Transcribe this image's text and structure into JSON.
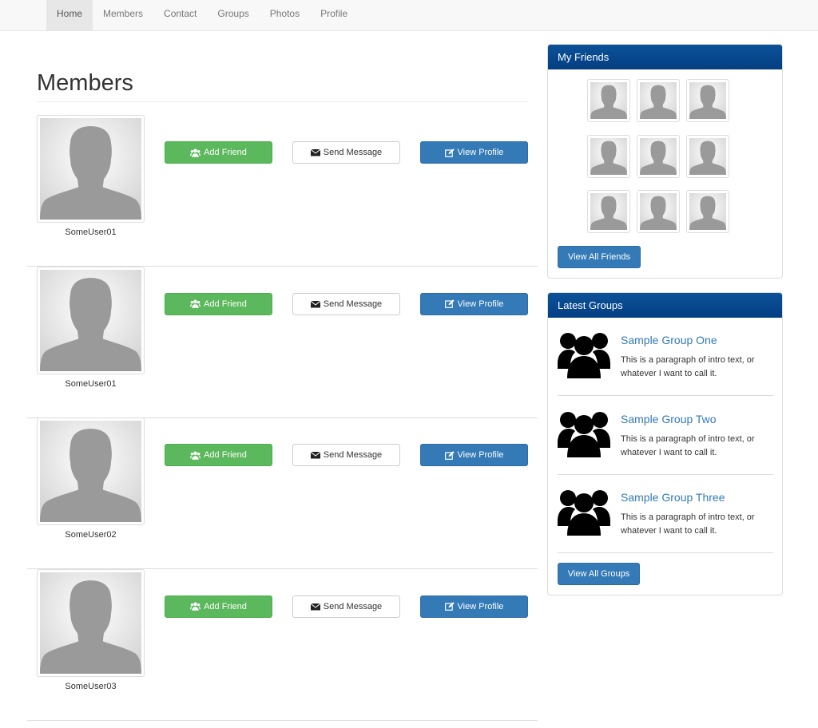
{
  "nav": {
    "items": [
      {
        "label": "Home",
        "active": true
      },
      {
        "label": "Members",
        "active": false
      },
      {
        "label": "Contact",
        "active": false
      },
      {
        "label": "Groups",
        "active": false
      },
      {
        "label": "Photos",
        "active": false
      },
      {
        "label": "Profile",
        "active": false
      }
    ]
  },
  "main": {
    "title": "Members",
    "members": [
      {
        "username": "SomeUser01"
      },
      {
        "username": "SomeUser01"
      },
      {
        "username": "SomeUser02"
      },
      {
        "username": "SomeUser03"
      }
    ],
    "buttons": {
      "add_friend": "Add Friend",
      "send_message": "Send Message",
      "view_profile": "View Profile"
    }
  },
  "friends_panel": {
    "title": "My Friends",
    "button": "View All Friends"
  },
  "groups_panel": {
    "title": "Latest Groups",
    "groups": [
      {
        "name": "Sample Group One",
        "description": "This is a paragraph of intro text, or whatever I want to call it."
      },
      {
        "name": "Sample Group Two",
        "description": "This is a paragraph of intro text, or whatever I want to call it."
      },
      {
        "name": "Sample Group Three",
        "description": "This is a paragraph of intro text, or whatever I want to call it."
      }
    ],
    "button": "View All Groups"
  },
  "colors": {
    "success": "#5cb85c",
    "primary": "#337ab7",
    "panel_heading": "#0b5299"
  },
  "icons": {
    "avatar": "person-silhouette-icon",
    "add_friend": "users-icon",
    "send_message": "envelope-icon",
    "view_profile": "edit-icon",
    "group": "group-icon"
  }
}
